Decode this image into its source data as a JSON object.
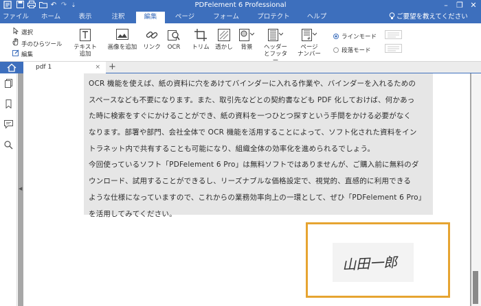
{
  "app": {
    "title": "PDFelement 6 Professional",
    "quick_access": [
      "💾",
      "🖫",
      "⎘",
      "↶",
      "↷",
      "⇣"
    ],
    "window_controls": [
      "–",
      "❐",
      "✕"
    ]
  },
  "menu": {
    "items": [
      "ファイル",
      "ホーム",
      "表示",
      "注釈",
      "編集",
      "ページ",
      "フォーム",
      "プロテクト",
      "ヘルプ"
    ],
    "active": "編集",
    "help_search": "ご要望を教えてください"
  },
  "ribbon": {
    "select": "選択",
    "hand_tool": "手のひらツール",
    "edit": "編集",
    "add_text": [
      "テキスト",
      "追加"
    ],
    "add_image": "画像を追加",
    "link": "リンク",
    "ocr": "OCR",
    "crop": "トリム",
    "watermark": "透かし",
    "background": "背景",
    "header_footer": [
      "ヘッダー",
      "とフッター"
    ],
    "page_number": [
      "ページ",
      "ナンバー"
    ],
    "line_mode": "ラインモード",
    "paragraph_mode": "段落モード"
  },
  "tabs": {
    "document": "pdf 1",
    "close": "×",
    "add": "+"
  },
  "document": {
    "lines": [
      "OCR 機能を使えば、紙の資料に穴をあけてバインダーに入れる作業や、バインダーを入れるための",
      "スペースなども不要になります。また、取引先などとの契約書なども PDF 化しておけば、何かあっ",
      "た時に検索をすぐにかけることができ、紙の資料を一つひとつ探すという手間をかける必要がなく",
      "なります。部署や部門、会社全体で OCR 機能を活用することによって、ソフト化された資料をイン",
      "トラネット内で共有することも可能になり、組織全体の効率化を進められるでしょう。",
      "今回使っているソフト「PDFelement 6 Pro」は無料ソフトではありませんが、ご購入前に無料のダ",
      "ウンロード、試用することができるし、リーズナブルな価格設定で、視覚的、直感的に利用できる",
      "ような仕様になっていますので、これからの業務効率向上の一環として、ぜひ「PDFelement 6 Pro」",
      "を活用してみてください。"
    ],
    "signature": "山田一郎"
  },
  "colors": {
    "brand_blue": "#3d6fbd",
    "highlight_orange": "#e6a431",
    "selection_grey": "#e6e6e6"
  }
}
